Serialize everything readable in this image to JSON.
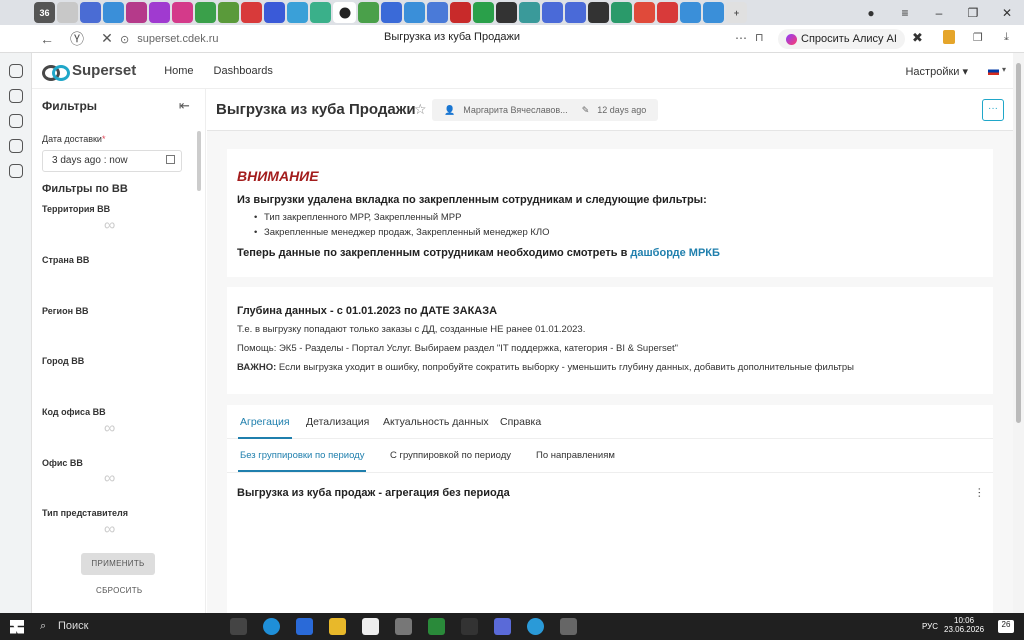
{
  "browser": {
    "url": "superset.cdek.ru",
    "page_title": "Выгрузка из куба Продажи",
    "alice_label": "Спросить Алису AI",
    "tab_count_badge": "36"
  },
  "topnav": {
    "brand": "Superset",
    "links": [
      "Home",
      "Dashboards"
    ],
    "settings": "Настройки ▾",
    "language_caret": "▾"
  },
  "sidebar": {
    "title": "Фильтры",
    "date_filter": {
      "label": "Дата доставки",
      "required_mark": "*",
      "value": "3 days ago : now"
    },
    "group_title": "Фильтры по ВВ",
    "filters": [
      "Территория ВВ",
      "Страна ВВ",
      "Регион ВВ",
      "Город ВВ",
      "Код офиса ВВ",
      "Офис ВВ",
      "Тип представителя"
    ],
    "apply_label": "ПРИМЕНИТЬ",
    "reset_label": "СБРОСИТЬ"
  },
  "header": {
    "title": "Выгрузка из куба Продажи",
    "owner": "Маргарита Вячеславов...",
    "modified": "12 days ago"
  },
  "notice": {
    "warning": "ВНИМАНИЕ",
    "intro": "Из выгрузки удалена вкладка по закрепленным сотрудникам и следующие фильтры:",
    "bullets": [
      "Тип закрепленного МРР, Закрепленный МРР",
      "Закрепленные менеджер продаж, Закрепленный менеджер КЛО"
    ],
    "outro": "Теперь данные по закрепленным сотрудникам необходимо смотреть в",
    "link": "дашборде МРКБ"
  },
  "depth": {
    "title": "Глубина данных - с 01.01.2023 по ДАТЕ ЗАКАЗА",
    "line1": "Т.е. в выгрузку попадают только заказы с ДД, созданные НЕ ранее 01.01.2023.",
    "line2": "Помощь: ЭК5 - Разделы - Портал Услуг. Выбираем раздел \"IT поддержка, категория - BI & Superset\"",
    "line3_bold": "ВАЖНО:",
    "line3": "Если выгрузка уходит в ошибку, попробуйте сократить выборку - уменьшить глубину данных, добавить дополнительные фильтры"
  },
  "tabs": [
    "Агрегация",
    "Детализация",
    "Актуальность данных",
    "Справка"
  ],
  "subtabs": [
    "Без группировки по периоду",
    "С группировкой по периоду",
    "По направлениям"
  ],
  "chart_title": "Выгрузка из куба продаж - агрегация без периода",
  "taskbar": {
    "search": "Поиск",
    "lang": "РУС",
    "time": "10:06",
    "date": "23.06.2026",
    "notif": "26"
  }
}
